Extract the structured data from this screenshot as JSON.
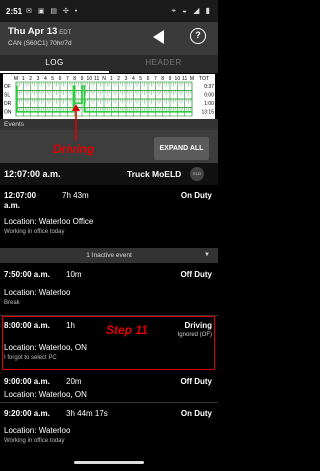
{
  "status_bar": {
    "time": "2:51",
    "left_icons": [
      "mail-icon",
      "message-icon",
      "image-icon",
      "fan-icon",
      "dot-icon"
    ],
    "right_icons": [
      "location-icon",
      "wifi-icon",
      "signal-icon",
      "battery-icon"
    ]
  },
  "header": {
    "date": "Thu Apr 13",
    "timezone": "EDT",
    "cycle": "CAN (S60C1) 70hr/7d"
  },
  "tabs": [
    {
      "label": "LOG",
      "active": true
    },
    {
      "label": "HEADER",
      "active": false
    }
  ],
  "graph": {
    "hour_labels": [
      "M",
      "1",
      "2",
      "3",
      "4",
      "5",
      "6",
      "7",
      "8",
      "9",
      "10",
      "11",
      "N",
      "1",
      "2",
      "3",
      "4",
      "5",
      "6",
      "7",
      "8",
      "9",
      "10",
      "11",
      "M"
    ],
    "row_labels": [
      "OF",
      "SL",
      "DR",
      "ON"
    ],
    "total_header": "TOT",
    "totals": [
      "0:37",
      "0:00",
      "1:00",
      "13:15"
    ],
    "colors": {
      "grid": "#2e9a3c",
      "line": "#2ecc40",
      "background": "#ffffff"
    }
  },
  "events_label": "Events",
  "annotation": {
    "driving": "Driving",
    "step": "Step 11"
  },
  "expand_button": "EXPAND ALL",
  "top_event": {
    "time": "12:07:00 a.m.",
    "logo_text": "Truck MoELD",
    "logo_badge": "ELD"
  },
  "events": [
    {
      "time": "12:07:00",
      "time2": "a.m.",
      "duration": "7h 43m",
      "status": "On Duty",
      "location": "Location: Waterloo Office",
      "note": "Working in office today"
    },
    {
      "time": "7:50:00 a.m.",
      "duration": "10m",
      "status": "Off Duty",
      "location": "Location: Waterloo",
      "note": "Break"
    },
    {
      "time": "8:00:00 a.m.",
      "duration": "1h",
      "status": "Driving",
      "status_sub": "Ignored (OF)",
      "location": "Location: Waterloo, ON",
      "note": "I forgot to select PC"
    },
    {
      "time": "9:00:00 a.m.",
      "duration": "20m",
      "status": "Off Duty",
      "location": "Location: Waterloo, ON",
      "note": ""
    },
    {
      "time": "9:20:00 a.m.",
      "duration": "3h 44m 17s",
      "status": "On Duty",
      "location": "Location: Waterloo",
      "note": "Working in office today"
    }
  ],
  "inactive_bar": "1 Inactive event",
  "accent_color": "#e00000"
}
